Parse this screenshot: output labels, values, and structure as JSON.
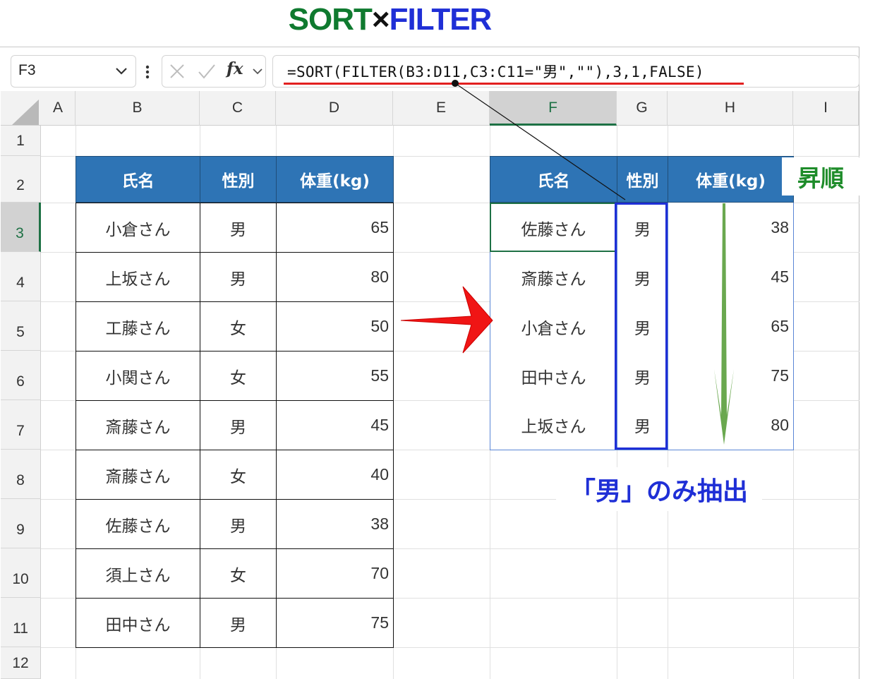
{
  "title": {
    "part1": "SORT",
    "part2": "×",
    "part3": "FILTER"
  },
  "formula_bar": {
    "name_box": "F3",
    "fx_label": "fx",
    "formula": "=SORT(FILTER(B3:D11,C3:C11=\"男\",\"\"),3,1,FALSE)"
  },
  "columns": [
    "A",
    "B",
    "C",
    "D",
    "E",
    "F",
    "G",
    "H",
    "I"
  ],
  "rows": [
    "1",
    "2",
    "3",
    "4",
    "5",
    "6",
    "7",
    "8",
    "9",
    "10",
    "11",
    "12"
  ],
  "selected_cell": "F3",
  "source_table": {
    "headers": [
      "氏名",
      "性別",
      "体重(kg)"
    ],
    "rows": [
      [
        "小倉さん",
        "男",
        "65"
      ],
      [
        "上坂さん",
        "男",
        "80"
      ],
      [
        "工藤さん",
        "女",
        "50"
      ],
      [
        "小関さん",
        "女",
        "55"
      ],
      [
        "斎藤さん",
        "男",
        "45"
      ],
      [
        "斎藤さん",
        "女",
        "40"
      ],
      [
        "佐藤さん",
        "男",
        "38"
      ],
      [
        "須上さん",
        "女",
        "70"
      ],
      [
        "田中さん",
        "男",
        "75"
      ]
    ]
  },
  "result_table": {
    "headers": [
      "氏名",
      "性別",
      "体重(kg)"
    ],
    "rows": [
      [
        "佐藤さん",
        "男",
        "38"
      ],
      [
        "斎藤さん",
        "男",
        "45"
      ],
      [
        "小倉さん",
        "男",
        "65"
      ],
      [
        "田中さん",
        "男",
        "75"
      ],
      [
        "上坂さん",
        "男",
        "80"
      ]
    ]
  },
  "annotations": {
    "ascending": "昇順",
    "male_only": "「男」のみ抽出"
  },
  "colors": {
    "header_fill": "#2e74b5",
    "arrow_red": "#f01515",
    "arrow_green": "#6aa84f",
    "highlight_blue": "#1f2fd6",
    "underline_red": "#e32020",
    "selection_green": "#1e7145"
  }
}
